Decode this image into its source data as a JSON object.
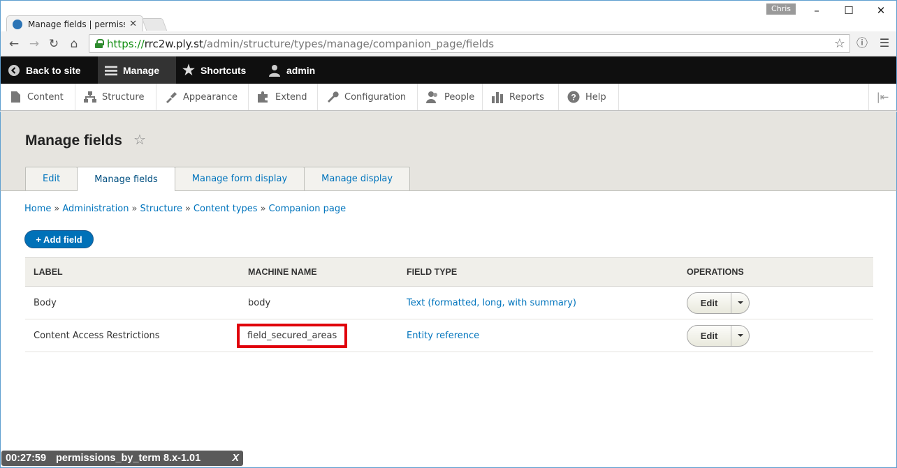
{
  "browser": {
    "tab_title": "Manage fields | permissio",
    "profile": "Chris",
    "url_scheme": "https://",
    "url_host": "rrc2w.ply.st",
    "url_path": "/admin/structure/types/manage/companion_page/fields"
  },
  "toolbar": {
    "back": "Back to site",
    "manage": "Manage",
    "shortcuts": "Shortcuts",
    "user": "admin"
  },
  "tray": {
    "content": "Content",
    "structure": "Structure",
    "appearance": "Appearance",
    "extend": "Extend",
    "configuration": "Configuration",
    "people": "People",
    "reports": "Reports",
    "help": "Help"
  },
  "page": {
    "title": "Manage fields",
    "tabs": [
      "Edit",
      "Manage fields",
      "Manage form display",
      "Manage display"
    ]
  },
  "breadcrumb": [
    "Home",
    "Administration",
    "Structure",
    "Content types",
    "Companion page"
  ],
  "add_field": "+ Add field",
  "table": {
    "headers": [
      "LABEL",
      "MACHINE NAME",
      "FIELD TYPE",
      "OPERATIONS"
    ],
    "rows": [
      {
        "label": "Body",
        "machine_name": "body",
        "field_type": "Text (formatted, long, with summary)",
        "op": "Edit"
      },
      {
        "label": "Content Access Restrictions",
        "machine_name": "field_secured_areas",
        "field_type": "Entity reference",
        "op": "Edit"
      }
    ]
  },
  "overlay": {
    "time": "00:27:59",
    "caption": "permissions_by_term 8.x-1.01",
    "close": "X"
  },
  "colors": {
    "link": "#0074bd",
    "highlight": "#e0000b",
    "toolbar": "#0f0f0f",
    "primary_button": "#0071b8"
  }
}
